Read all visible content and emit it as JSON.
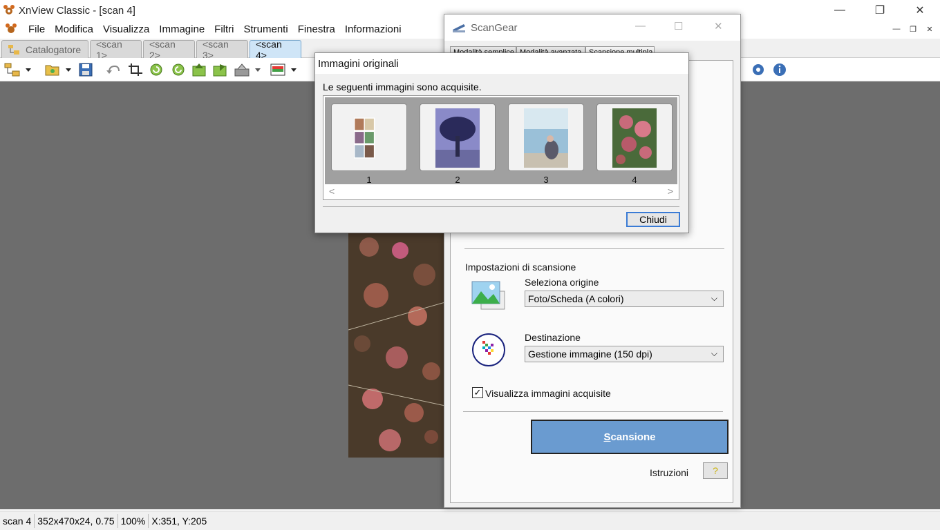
{
  "window": {
    "title": "XnView Classic - [scan 4]",
    "controls": {
      "minimize": "—",
      "maximize": "❐",
      "close": "✕"
    }
  },
  "menu": {
    "items": [
      "File",
      "Modifica",
      "Visualizza",
      "Immagine",
      "Filtri",
      "Strumenti",
      "Finestra",
      "Informazioni"
    ]
  },
  "tabs": [
    {
      "label": "Catalogatore",
      "active": false
    },
    {
      "label": "<scan 1>",
      "active": false
    },
    {
      "label": "<scan 2>",
      "active": false
    },
    {
      "label": "<scan 3>",
      "active": false
    },
    {
      "label": "<scan 4>",
      "active": true
    }
  ],
  "toolbar": {
    "icons": [
      "browser-icon",
      "open-folder-icon",
      "save-icon",
      "undo-icon",
      "crop-icon",
      "rotate-left-icon",
      "rotate-right-icon",
      "previous-icon",
      "next-icon",
      "acquire-icon",
      "adjust-icon",
      "settings-icon",
      "info-icon"
    ]
  },
  "status": {
    "name": "scan 4",
    "info": "352x470x24, 0.75",
    "zoom": "100%",
    "coords": "X:351, Y:205"
  },
  "scangear": {
    "title": "ScanGear",
    "tabs": [
      "Modalità semplice",
      "Modalità avanzata",
      "Scansione multipla"
    ],
    "settings_heading": "Impostazioni di scansione",
    "source_label": "Seleziona origine",
    "source_value": "Foto/Scheda (A colori)",
    "dest_label": "Destinazione",
    "dest_value": "Gestione immagine (150 dpi)",
    "show_images_label": "Visualizza immagini acquisite",
    "show_images_checked": "✓",
    "scan_button_first": "S",
    "scan_button_rest": "cansione",
    "instructions_label": "Istruzioni",
    "help_icon": "?"
  },
  "dialog": {
    "title": "Immagini originali",
    "message": "Le seguenti immagini sono acquisite.",
    "thumbnails": [
      "1",
      "2",
      "3",
      "4"
    ],
    "scroll_left": "<",
    "scroll_right": ">",
    "close_button": "Chiudi"
  },
  "colors": {
    "workspace": "#6d6d6d",
    "active_tab": "#cfe5f7",
    "scan_button": "#6a9bd0"
  }
}
